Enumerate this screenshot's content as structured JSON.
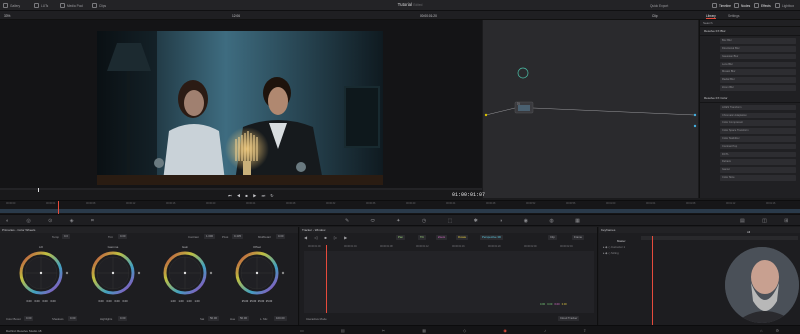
{
  "app": {
    "title": "Tutorial",
    "subtitle": "Edited",
    "bottom_left": "DaVinci Resolve Studio 18",
    "accent": "#e64b3c"
  },
  "top_tabs_left": [
    "Gallery",
    "LUTs",
    "Media Pool",
    "Clips"
  ],
  "top_tabs_right": [
    "Timeline",
    "Nodes",
    "Effects",
    "Lightbox"
  ],
  "quick_export": "Quick Export",
  "subbar": {
    "zoom": "33%",
    "clip_name": "12:06",
    "timecode": "00:00:01:20",
    "clip_select": "Clip",
    "library_tab": "Library",
    "settings_tab": "Settings"
  },
  "viewer": {
    "timecode": "01:00:01:07"
  },
  "library": {
    "search": "Search",
    "sections": [
      {
        "name": "Resolve FX Blur",
        "items": [
          "Box Blur",
          "Directional Blur",
          "Gaussian Blur",
          "Lens Blur",
          "Mosaic Blur",
          "Radial Blur",
          "Zoom Blur"
        ]
      },
      {
        "name": "Resolve FX Color",
        "items": [
          "ACES Transform",
          "Chromatic Adaptation",
          "Color Compressor",
          "Color Space Transform",
          "Color Stabilizer",
          "Contrast Pop",
          "DCTL",
          "Dehaze",
          "Gamut",
          "Color Slice"
        ]
      }
    ]
  },
  "timeline_marks": [
    "00:00:00",
    "00:00:04",
    "00:00:08",
    "00:00:12",
    "00:00:16",
    "00:00:20",
    "00:00:24",
    "00:00:28",
    "00:00:32",
    "00:00:36",
    "00:00:40",
    "00:00:44",
    "00:00:48",
    "00:00:52",
    "00:00:56",
    "00:01:00",
    "00:01:04",
    "00:01:08",
    "00:01:12",
    "00:01:16"
  ],
  "primaries": {
    "title": "Primaries - Color Wheels",
    "temp_label": "Temp",
    "temp_value": "0.0",
    "tint_label": "Tint",
    "tint_value": "0.00",
    "contrast_label": "Contrast",
    "contrast_value": "1.000",
    "pivot_label": "Pivot",
    "pivot_value": "0.435",
    "md_label": "Mid/Detail",
    "md_value": "0.00",
    "wheels": [
      {
        "name": "Lift",
        "values": [
          "0.00",
          "0.00",
          "0.00",
          "0.00"
        ]
      },
      {
        "name": "Gamma",
        "values": [
          "0.00",
          "0.00",
          "0.00",
          "0.00"
        ]
      },
      {
        "name": "Gain",
        "values": [
          "1.00",
          "1.00",
          "1.00",
          "1.00"
        ]
      },
      {
        "name": "Offset",
        "values": [
          "25.00",
          "25.00",
          "25.00",
          "25.00"
        ]
      }
    ],
    "bottom": [
      {
        "label": "Color Boost",
        "value": "0.00"
      },
      {
        "label": "Shadows",
        "value": "0.00"
      },
      {
        "label": "Highlights",
        "value": "0.00"
      },
      {
        "label": "Sat",
        "value": "50.00"
      },
      {
        "label": "Hue",
        "value": "50.00"
      },
      {
        "label": "L. Mix",
        "value": "100.00"
      }
    ]
  },
  "tracker": {
    "title": "Tracker - Window",
    "checks": [
      "Pan",
      "Tilt",
      "Zoom",
      "Rotate",
      "Perspective 3D"
    ],
    "clip_btn": "Clip",
    "frame_btn": "Frame",
    "ruler": [
      "00:00:01:00",
      "00:00:01:04",
      "00:00:01:08",
      "00:00:01:12",
      "00:00:01:16",
      "00:00:01:20",
      "00:00:02:00",
      "00:00:02:04"
    ],
    "values": [
      "0.00",
      "0.00",
      "0.00",
      "0.00"
    ],
    "mode_label": "Interactive Mode",
    "track_select": "Cloud Tracker"
  },
  "node_graph": {
    "title": "Keyframes",
    "tab": "All",
    "rows": [
      "Master",
      "Corrector 1",
      "Sizing"
    ]
  }
}
